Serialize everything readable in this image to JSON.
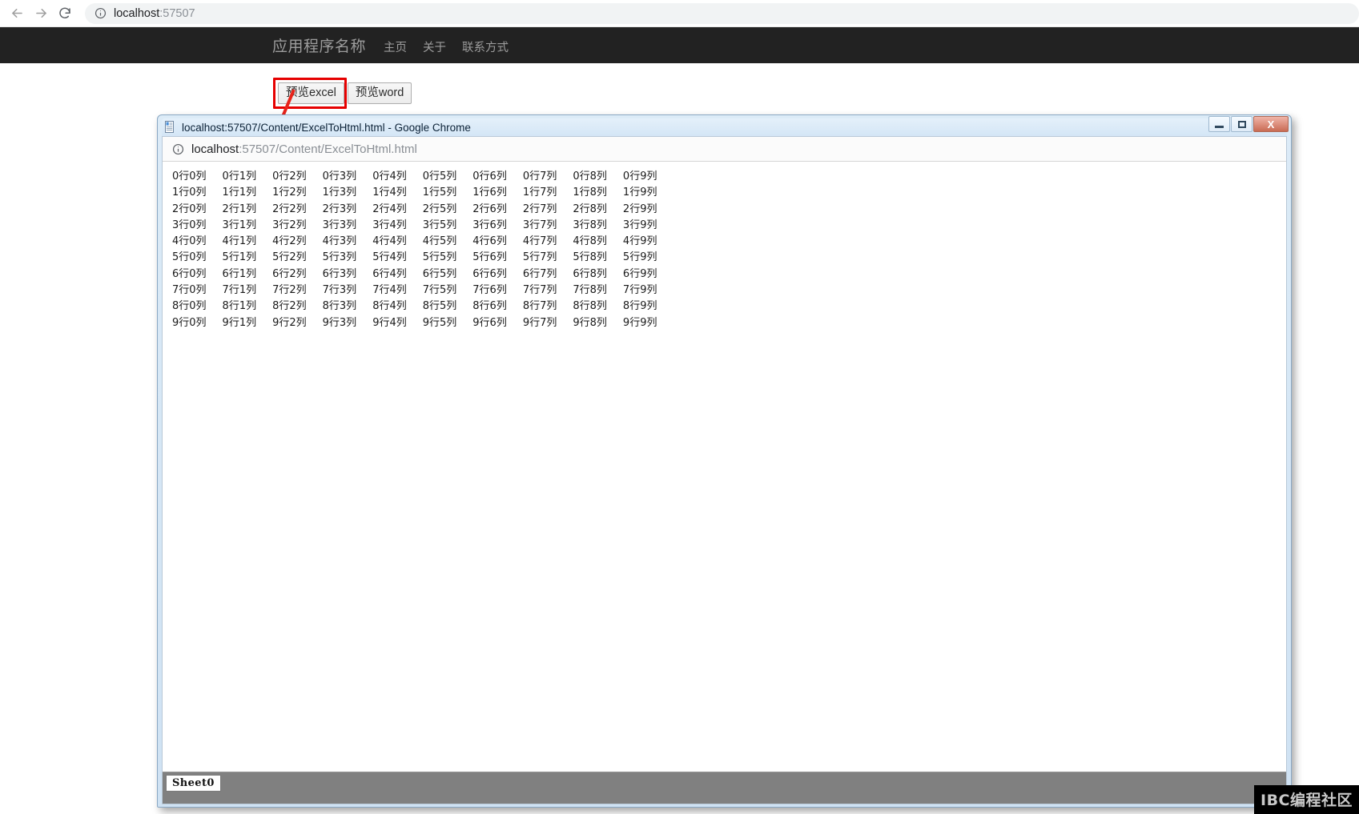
{
  "outer_browser": {
    "back_icon": "arrow-left-icon",
    "forward_icon": "arrow-right-icon",
    "reload_icon": "reload-icon",
    "info_icon": "info-circle-icon",
    "url_host": "localhost",
    "url_rest": ":57507"
  },
  "site_nav": {
    "brand": "应用程序名称",
    "links": [
      {
        "label": "主页"
      },
      {
        "label": "关于"
      },
      {
        "label": "联系方式"
      }
    ]
  },
  "page_buttons": {
    "excel_label": "预览excel",
    "word_label": "预览word",
    "highlight_color": "#e60000",
    "arrow_color": "#e8231a"
  },
  "popup": {
    "title": "localhost:57507/Content/ExcelToHtml.html - Google Chrome",
    "doc_icon": "page-icon",
    "window_controls": {
      "minimize": "minimize-icon",
      "maximize": "maximize-icon",
      "close": "X"
    },
    "omnibar": {
      "info_icon": "info-circle-icon",
      "url_host": "localhost",
      "url_rest": ":57507/Content/ExcelToHtml.html"
    },
    "sheet_tab": "Sheet0"
  },
  "watermark": "IBC编程社区",
  "chart_data": {
    "type": "table",
    "title": "ExcelToHtml.html rendered sheet",
    "rows": 10,
    "cols": 10,
    "cells": [
      [
        "0行0列",
        "0行1列",
        "0行2列",
        "0行3列",
        "0行4列",
        "0行5列",
        "0行6列",
        "0行7列",
        "0行8列",
        "0行9列"
      ],
      [
        "1行0列",
        "1行1列",
        "1行2列",
        "1行3列",
        "1行4列",
        "1行5列",
        "1行6列",
        "1行7列",
        "1行8列",
        "1行9列"
      ],
      [
        "2行0列",
        "2行1列",
        "2行2列",
        "2行3列",
        "2行4列",
        "2行5列",
        "2行6列",
        "2行7列",
        "2行8列",
        "2行9列"
      ],
      [
        "3行0列",
        "3行1列",
        "3行2列",
        "3行3列",
        "3行4列",
        "3行5列",
        "3行6列",
        "3行7列",
        "3行8列",
        "3行9列"
      ],
      [
        "4行0列",
        "4行1列",
        "4行2列",
        "4行3列",
        "4行4列",
        "4行5列",
        "4行6列",
        "4行7列",
        "4行8列",
        "4行9列"
      ],
      [
        "5行0列",
        "5行1列",
        "5行2列",
        "5行3列",
        "5行4列",
        "5行5列",
        "5行6列",
        "5行7列",
        "5行8列",
        "5行9列"
      ],
      [
        "6行0列",
        "6行1列",
        "6行2列",
        "6行3列",
        "6行4列",
        "6行5列",
        "6行6列",
        "6行7列",
        "6行8列",
        "6行9列"
      ],
      [
        "7行0列",
        "7行1列",
        "7行2列",
        "7行3列",
        "7行4列",
        "7行5列",
        "7行6列",
        "7行7列",
        "7行8列",
        "7行9列"
      ],
      [
        "8行0列",
        "8行1列",
        "8行2列",
        "8行3列",
        "8行4列",
        "8行5列",
        "8行6列",
        "8行7列",
        "8行8列",
        "8行9列"
      ],
      [
        "9行0列",
        "9行1列",
        "9行2列",
        "9行3列",
        "9行4列",
        "9行5列",
        "9行6列",
        "9行7列",
        "9行8列",
        "9行9列"
      ]
    ]
  }
}
